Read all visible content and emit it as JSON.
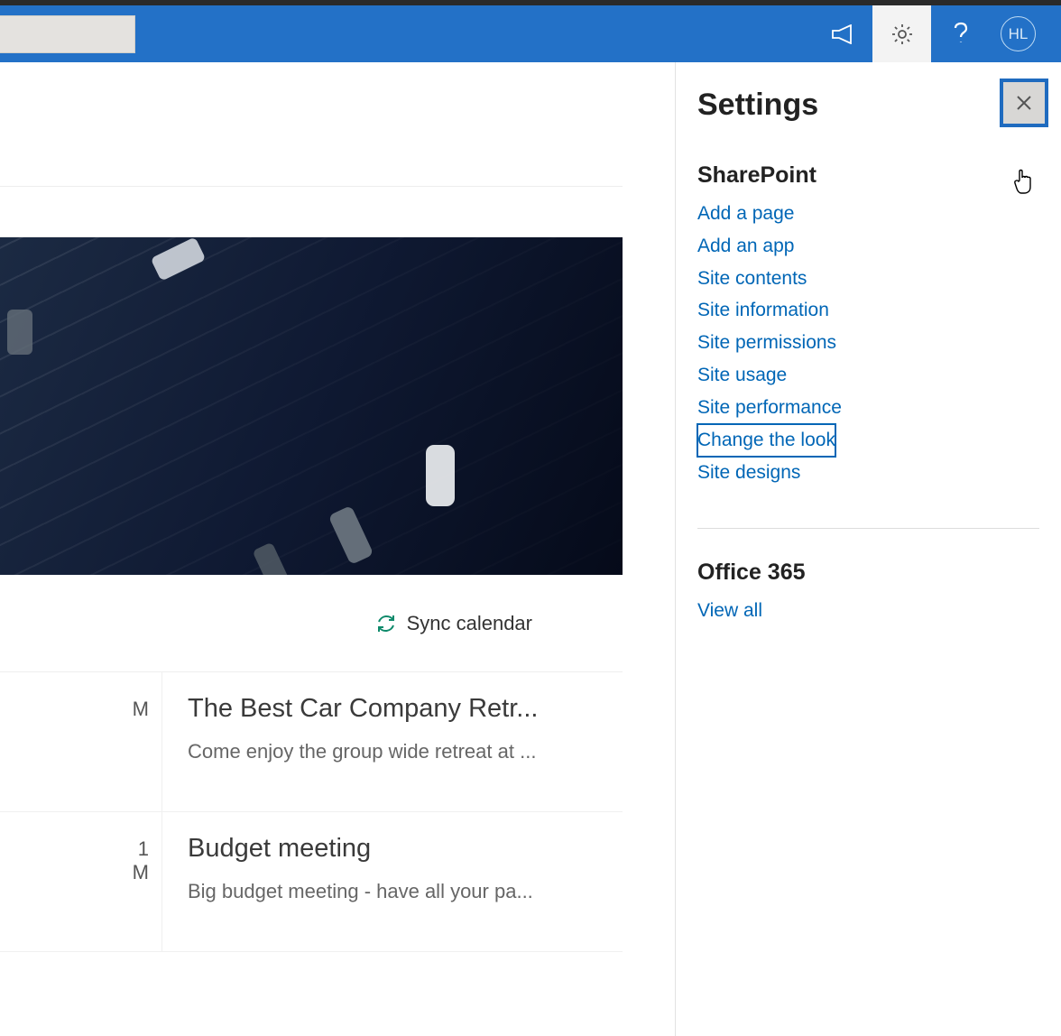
{
  "header": {
    "avatar_initials": "HL"
  },
  "settings_panel": {
    "title": "Settings",
    "sections": [
      {
        "heading": "SharePoint",
        "links": [
          {
            "label": "Add a page",
            "focused": false
          },
          {
            "label": "Add an app",
            "focused": false
          },
          {
            "label": "Site contents",
            "focused": false
          },
          {
            "label": "Site information",
            "focused": false
          },
          {
            "label": "Site permissions",
            "focused": false
          },
          {
            "label": "Site usage",
            "focused": false
          },
          {
            "label": "Site performance",
            "focused": false
          },
          {
            "label": "Change the look",
            "focused": true
          },
          {
            "label": "Site designs",
            "focused": false
          }
        ]
      },
      {
        "heading": "Office 365",
        "links": [
          {
            "label": "View all",
            "focused": false
          }
        ]
      }
    ]
  },
  "main": {
    "sync_label": "Sync calendar",
    "events": [
      {
        "left_text": "M",
        "title": "The Best Car Company Retr...",
        "desc": "Come enjoy the group wide retreat at ..."
      },
      {
        "left_text": "1\nM",
        "title": "Budget meeting",
        "desc": "Big budget meeting - have all your pa..."
      }
    ]
  }
}
